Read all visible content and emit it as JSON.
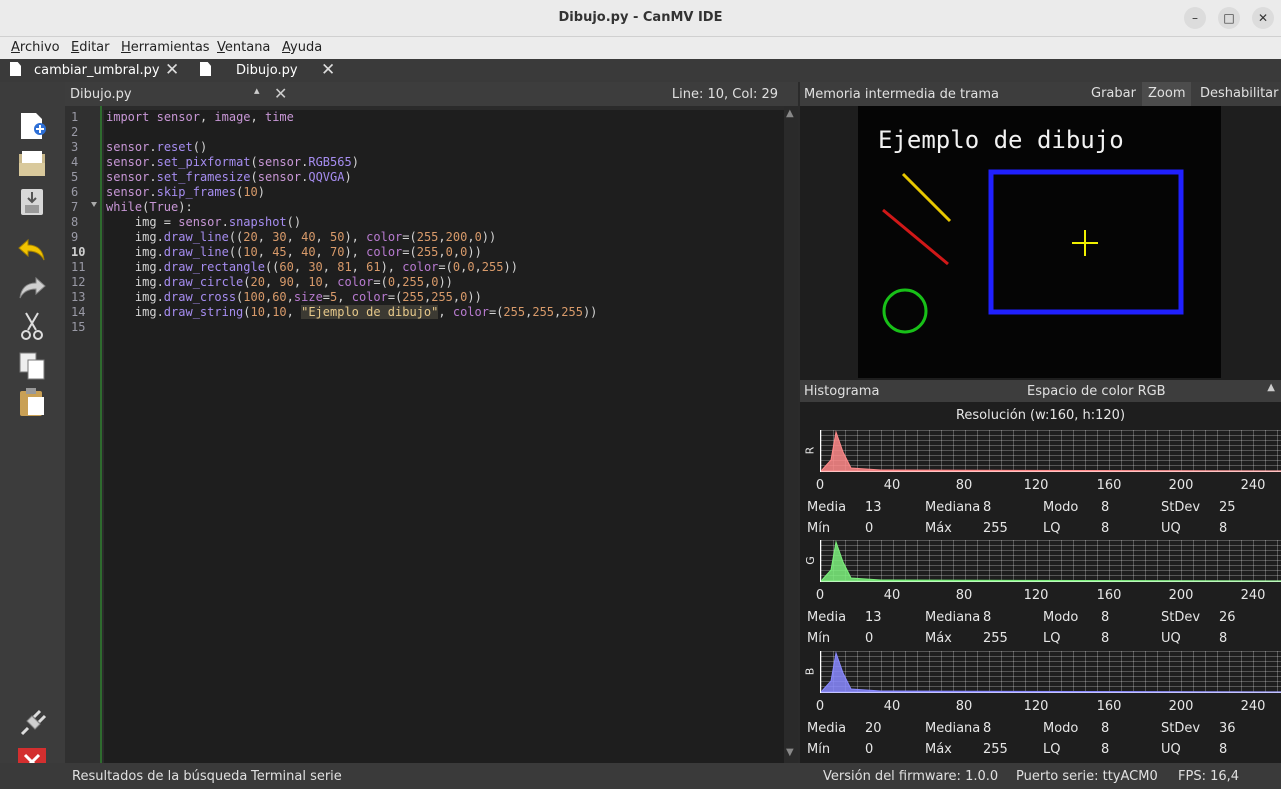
{
  "window": {
    "title": "Dibujo.py - CanMV IDE"
  },
  "menu": [
    "Archivo",
    "Editar",
    "Herramientas",
    "Ventana",
    "Ayuda"
  ],
  "tabs": [
    {
      "label": "cambiar_umbral.py"
    },
    {
      "label": "Dibujo.py"
    }
  ],
  "editor": {
    "file_name": "Dibujo.py",
    "cursor_position": "Line: 10, Col: 29",
    "line_numbers": [
      "1",
      "2",
      "3",
      "4",
      "5",
      "6",
      "7",
      "8",
      "9",
      "10",
      "11",
      "12",
      "13",
      "14",
      "15"
    ],
    "current_line": 10,
    "code_lines": [
      "import sensor, image, time",
      "",
      "sensor.reset()",
      "sensor.set_pixformat(sensor.RGB565)",
      "sensor.set_framesize(sensor.QQVGA)",
      "sensor.skip_frames(10)",
      "while(True):",
      "    img = sensor.snapshot()",
      "    img.draw_line((20, 30, 40, 50), color=(255,200,0))",
      "    img.draw_line((10, 45, 40, 70), color=(255,0,0))",
      "    img.draw_rectangle((60, 30, 81, 61), color=(0,0,255))",
      "    img.draw_circle(20, 90, 10, color=(0,255,0))",
      "    img.draw_cross(100,60,size=5, color=(255,255,0))",
      "    img.draw_string(10,10, \"Ejemplo de dibujo\", color=(255,255,255))",
      ""
    ]
  },
  "framebuffer": {
    "title": "Memoria intermedia de trama",
    "buttons": {
      "record": "Grabar",
      "zoom": "Zoom",
      "disable": "Deshabilitar"
    },
    "image_text": "Ejemplo de dibujo"
  },
  "histogram": {
    "title": "Histograma",
    "color_space": "Espacio de color RGB",
    "resolution": "Resolución (w:160, h:120)",
    "ticks": [
      "0",
      "40",
      "80",
      "120",
      "160",
      "200",
      "240"
    ],
    "stat_labels": {
      "mean": "Media",
      "median": "Mediana",
      "mode": "Modo",
      "stdev": "StDev",
      "min": "Mín",
      "max": "Máx",
      "lq": "LQ",
      "uq": "UQ"
    },
    "channels": [
      {
        "name": "R",
        "color": "#ff8a8a",
        "mean": "13",
        "median": "8",
        "mode": "8",
        "stdev": "25",
        "min": "0",
        "max": "255",
        "lq": "8",
        "uq": "8"
      },
      {
        "name": "G",
        "color": "#7cf07c",
        "mean": "13",
        "median": "8",
        "mode": "8",
        "stdev": "26",
        "min": "0",
        "max": "255",
        "lq": "8",
        "uq": "8"
      },
      {
        "name": "B",
        "color": "#8a8aff",
        "mean": "20",
        "median": "8",
        "mode": "8",
        "stdev": "36",
        "min": "0",
        "max": "255",
        "lq": "8",
        "uq": "8"
      }
    ]
  },
  "statusbar": {
    "search_results": "Resultados de la búsqueda",
    "serial_terminal": "Terminal serie",
    "firmware": "Versión del firmware: 1.0.0",
    "serial_port": "Puerto serie: ttyACM0",
    "fps": "FPS:  16,4"
  }
}
